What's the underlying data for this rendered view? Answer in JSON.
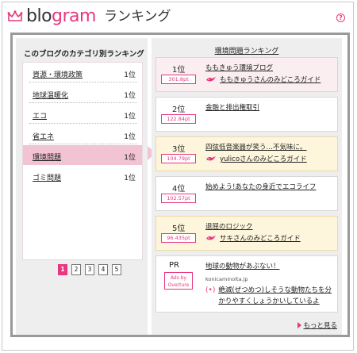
{
  "header": {
    "logo_text_b": "blo",
    "logo_text_g": "gram",
    "subtitle": "ランキング",
    "help_label": "?"
  },
  "left": {
    "title": "このブログのカテゴリ別ランキング",
    "categories": [
      {
        "label": "資源・環境政策",
        "rank": "1位"
      },
      {
        "label": "地球温暖化",
        "rank": "1位"
      },
      {
        "label": "エコ",
        "rank": "1位"
      },
      {
        "label": "省エネ",
        "rank": "1位"
      },
      {
        "label": "環境問題",
        "rank": "1位"
      },
      {
        "label": "ゴミ問題",
        "rank": "1位"
      }
    ],
    "pages": [
      "1",
      "2",
      "3",
      "4",
      "5"
    ]
  },
  "right": {
    "title": "環境問題ランキング",
    "entries": [
      {
        "rank": "1位",
        "score": "301.8pt",
        "blog": "ももきゅう環境ブログ",
        "guide": "ももきゅうさんのみどころガイド"
      },
      {
        "rank": "2位",
        "score": "122.84pt",
        "blog": "金融と排出権取引",
        "guide": ""
      },
      {
        "rank": "3位",
        "score": "104.79pt",
        "blog": "四弦低音楽器が笑う…不気味に。",
        "guide": "yulicoさんのみどころガイド"
      },
      {
        "rank": "4位",
        "score": "102.57pt",
        "blog": "始めよう!あなたの身近でエコライフ",
        "guide": ""
      },
      {
        "rank": "5位",
        "score": "96.435pt",
        "blog": "退屈のロジック",
        "guide": "サキさんのみどころガイド"
      }
    ],
    "pr": {
      "rank": "PR",
      "ads_line1": "Ads by",
      "ads_line2": "Overture",
      "title": "地球の動物があぶない！",
      "url": "konicaminolta.jp",
      "desc": "絶滅(ぜつめつ)しそうな動物たちを分かりやすくしょうかいしているよ"
    },
    "more": "もっと見る"
  },
  "colors": {
    "accent": "#e8377e",
    "active_bg": "#f2c3d2",
    "frame_grey": "#9a9a9a"
  }
}
